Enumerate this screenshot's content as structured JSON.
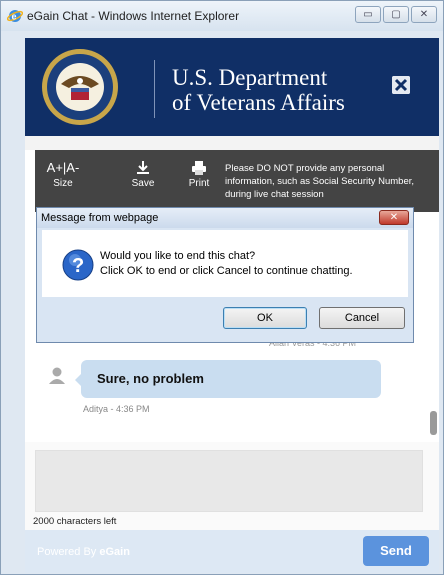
{
  "window": {
    "title": "eGain Chat - Windows Internet Explorer",
    "controls": {
      "minimize": "▭",
      "maximize": "▢",
      "close": "✕"
    }
  },
  "header": {
    "line1": "U.S. Department",
    "line2": "of Veterans Affairs",
    "close_icon": "x-icon"
  },
  "toolbar": {
    "size": {
      "icon": "A+|A-",
      "label": "Size"
    },
    "save": {
      "icon": "save-icon",
      "label": "Save"
    },
    "print": {
      "icon": "printer-icon",
      "label": "Print"
    },
    "notice": "Please DO NOT provide any personal information, such as Social Security Number, during live chat session"
  },
  "chat": {
    "agent_meta": "Allan Veras - 4:36 PM",
    "message": "Sure, no problem",
    "user_meta": "Aditya - 4:36 PM"
  },
  "compose": {
    "chars_left": "2000 characters left",
    "powered_by": "Powered By",
    "brand": "eGain",
    "send_label": "Send"
  },
  "dialog": {
    "title": "Message from webpage",
    "close_label": "✕",
    "line1": "Would you like to end this chat?",
    "line2": "Click OK to end or click Cancel to continue chatting.",
    "ok_label": "OK",
    "cancel_label": "Cancel"
  },
  "colors": {
    "va_blue": "#102f66",
    "toolbar_gray": "#444444",
    "bubble": "#c9ddf0",
    "send": "#5b93dd",
    "dialog_frame": "#d9e5f3"
  }
}
